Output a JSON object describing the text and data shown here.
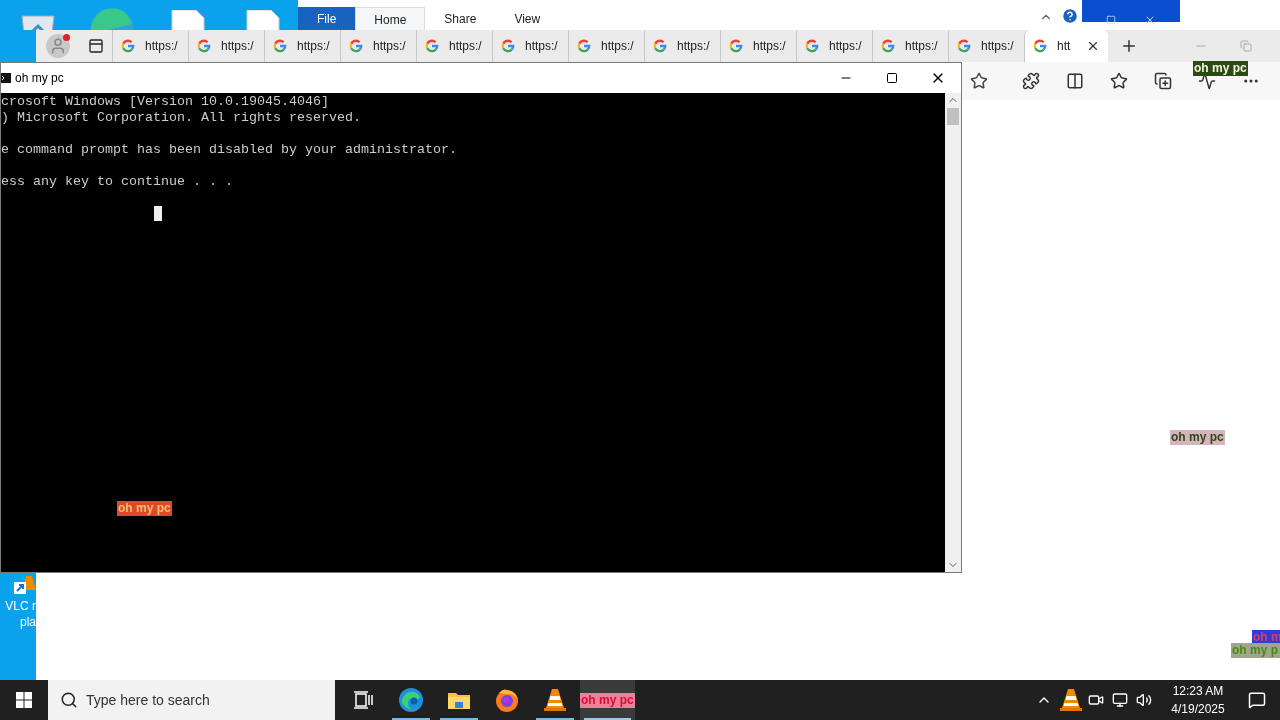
{
  "desktop": {
    "vlc_shortcut": {
      "label_lines": [
        "VLC r",
        "pla"
      ]
    },
    "corner_labels": [
      {
        "text": "oh m",
        "kind": "blue"
      },
      {
        "text": "oh my p",
        "kind": "olive"
      }
    ]
  },
  "explorer": {
    "ribbon_tabs": [
      {
        "label": "File",
        "kind": "file",
        "selected": false
      },
      {
        "label": "Home",
        "kind": "tab",
        "selected": true
      },
      {
        "label": "Share",
        "kind": "tab",
        "selected": false
      },
      {
        "label": "View",
        "kind": "tab",
        "selected": false
      }
    ]
  },
  "browser": {
    "tabs": [
      {
        "title": "https:/",
        "selected": false
      },
      {
        "title": "https:/",
        "selected": false
      },
      {
        "title": "https:/",
        "selected": false
      },
      {
        "title": "https:/",
        "selected": false
      },
      {
        "title": "https:/",
        "selected": false
      },
      {
        "title": "https:/",
        "selected": false
      },
      {
        "title": "https:/",
        "selected": false
      },
      {
        "title": "https:/",
        "selected": false
      },
      {
        "title": "https:/",
        "selected": false
      },
      {
        "title": "https:/",
        "selected": false
      },
      {
        "title": "https:/",
        "selected": false
      },
      {
        "title": "https:/",
        "selected": false
      },
      {
        "title": "htt",
        "selected": true
      }
    ],
    "toolbar_label": "oh my pc",
    "page_label": "oh my pc"
  },
  "console": {
    "title": "oh my pc",
    "blocks": [
      {
        "lines": [
          "crosoft Windows [Version 10.0.19045.4046]",
          ") Microsoft Corporation. All rights reserved."
        ]
      },
      {
        "lines": [
          "e command prompt has been disabled by your administrator."
        ]
      },
      {
        "lines": [
          "ess any key to continue . . ."
        ]
      }
    ],
    "overlay_label": "oh my pc"
  },
  "taskbar": {
    "search": {
      "placeholder": "Type here to search"
    },
    "apps": [
      {
        "kind": "taskview",
        "running": false,
        "selected": false
      },
      {
        "kind": "edge",
        "running": true,
        "selected": false
      },
      {
        "kind": "explorer",
        "running": true,
        "selected": false
      },
      {
        "kind": "firefox",
        "running": false,
        "selected": false
      },
      {
        "kind": "vlc",
        "running": true,
        "selected": false
      },
      {
        "kind": "cmd",
        "running": true,
        "selected": true,
        "label": "oh my pc"
      }
    ],
    "clock": {
      "time": "12:23 AM",
      "date": "4/19/2025"
    }
  }
}
